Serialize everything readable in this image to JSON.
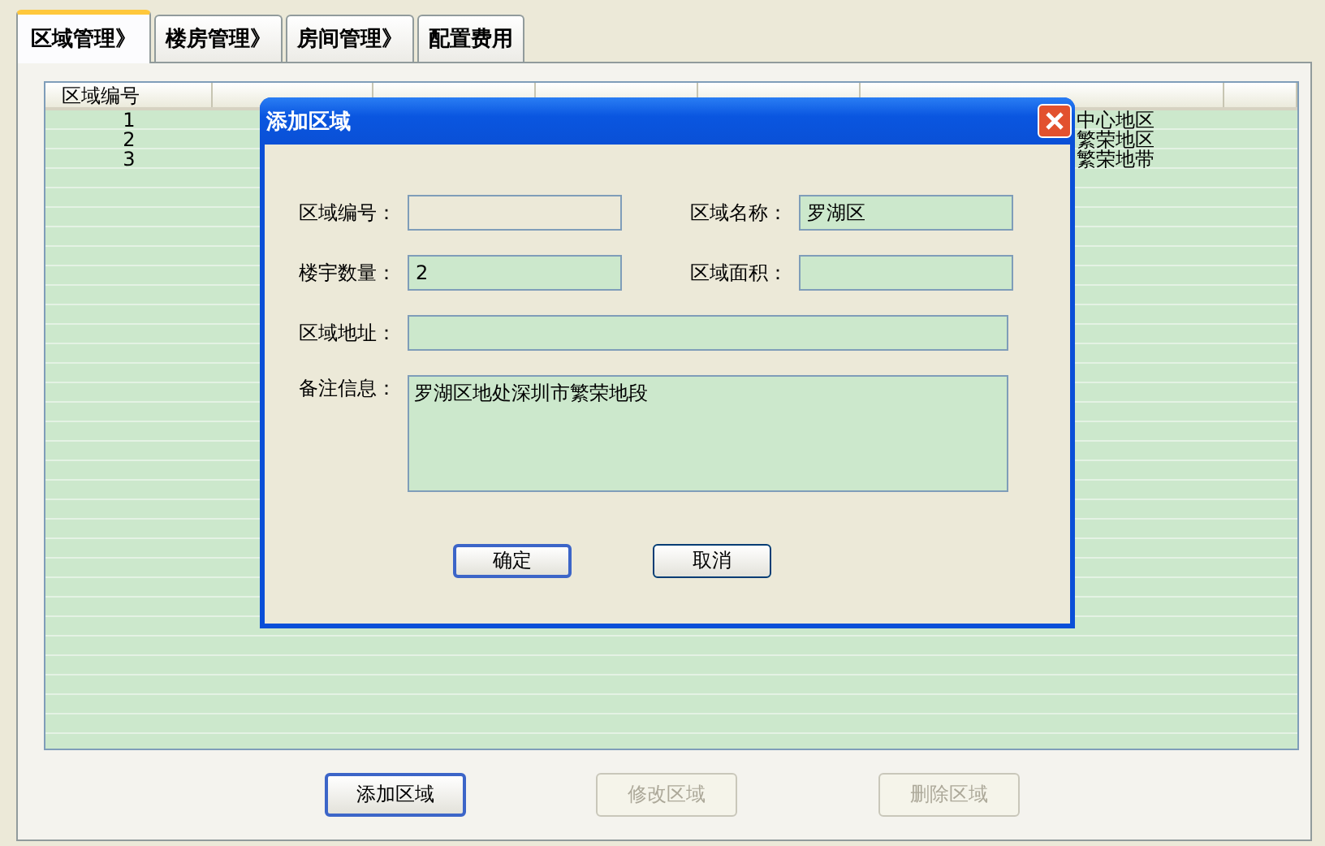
{
  "tabs": [
    {
      "label": "区域管理》",
      "selected": true
    },
    {
      "label": "楼房管理》",
      "selected": false
    },
    {
      "label": "房间管理》",
      "selected": false
    },
    {
      "label": "配置费用",
      "selected": false
    }
  ],
  "table": {
    "columns": [
      "区域编号"
    ],
    "rows": [
      {
        "id": "1",
        "remark": "中心地区"
      },
      {
        "id": "2",
        "remark": "繁荣地区"
      },
      {
        "id": "3",
        "remark": "繁荣地带"
      }
    ]
  },
  "buttons": [
    {
      "label": "添加区域",
      "disabled": false
    },
    {
      "label": "修改区域",
      "disabled": true
    },
    {
      "label": "删除区域",
      "disabled": true
    }
  ],
  "dialog": {
    "title": "添加区域",
    "fields": [
      {
        "label": "区域编号：",
        "readonly": true
      },
      {
        "label": "区域名称：",
        "value": "罗湖区",
        "readonly": false
      },
      {
        "label": "楼宇数量：",
        "value": "2",
        "readonly": false
      },
      {
        "label": "区域面积：",
        "readonly": false
      },
      {
        "label": "区域地址：",
        "readonly": false
      }
    ],
    "remark": {
      "label": "备注信息：",
      "value": "罗湖区地处深圳市繁荣地段"
    },
    "buttons": [
      {
        "label": "确定",
        "default": true
      },
      {
        "label": "取消",
        "default": false
      }
    ]
  }
}
